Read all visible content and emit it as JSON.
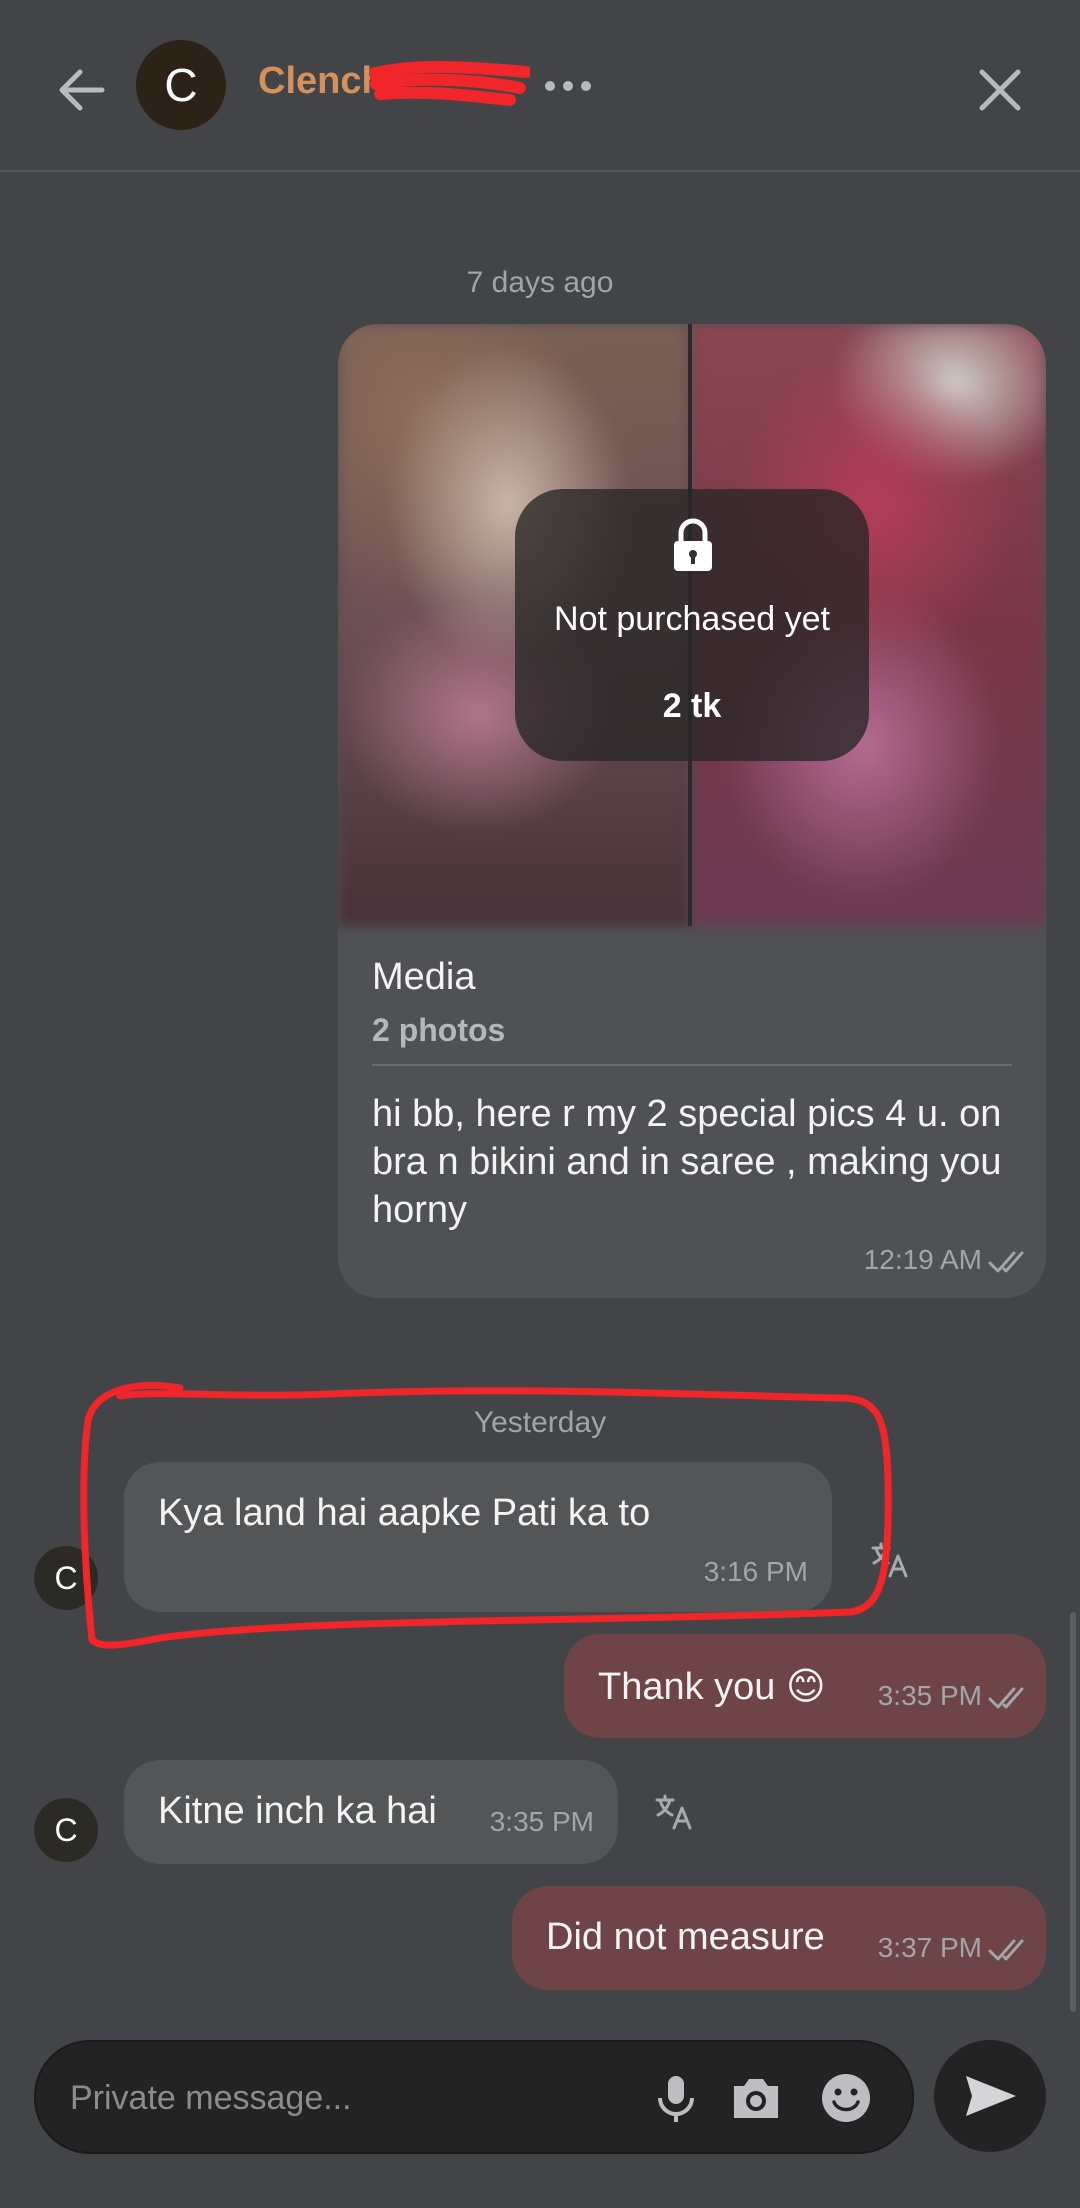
{
  "header": {
    "avatar_letter": "C",
    "contact_name": "Clench"
  },
  "thread": {
    "date_separator_1": "7 days ago",
    "media_message": {
      "lock_text": "Not purchased yet",
      "price": "2 tk",
      "title": "Media",
      "subtitle": "2 photos",
      "caption": "hi bb, here r my 2 special pics 4 u. on bra n bikini and in saree , making you horny",
      "time": "12:19 AM"
    },
    "date_separator_2": "Yesterday",
    "messages": [
      {
        "direction": "in",
        "avatar": "C",
        "text": "Kya land hai aapke Pati ka to",
        "time": "3:16 PM"
      },
      {
        "direction": "out",
        "text": "Thank you 😊",
        "time": "3:35 PM"
      },
      {
        "direction": "in",
        "avatar": "C",
        "text": "Kitne inch ka hai",
        "time": "3:35 PM"
      },
      {
        "direction": "out",
        "text": "Did not measure",
        "time": "3:37 PM"
      }
    ]
  },
  "composer": {
    "placeholder": "Private message..."
  },
  "icons": {
    "back": "arrow-left-icon",
    "more": "more-dots-icon",
    "close": "close-icon",
    "lock": "lock-icon",
    "read": "double-check-icon",
    "translate": "translate-icon",
    "mic": "microphone-icon",
    "camera": "camera-icon",
    "emoji": "emoji-icon",
    "send": "send-icon"
  },
  "colors": {
    "background": "#434447",
    "incoming_bubble": "#545557",
    "outgoing_bubble": "#6e4446",
    "name_accent": "#d5915c",
    "annotation_red": "#f0262a"
  }
}
